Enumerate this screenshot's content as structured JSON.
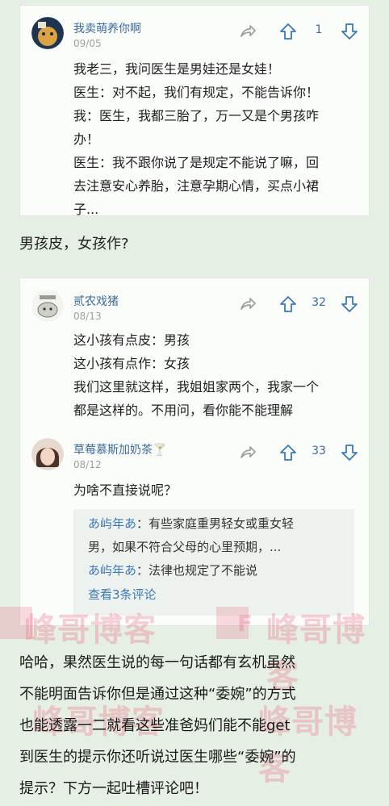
{
  "comment1": {
    "username": "我卖萌养你啊",
    "date": "09/05",
    "like_count": "1",
    "lines": [
      "我老三，我问医生是男娃还是女娃！",
      "医生：对不起，我们有规定，不能告诉你！",
      "我：医生，我都三胎了，万一又是个男孩咋",
      "办！",
      "医生：我不跟你说了是规定不能说了嘛，回",
      "去注意安心养胎，注意孕期心情，买点小裙",
      "子..."
    ]
  },
  "middle_text": "男孩皮，女孩作?",
  "comment2": {
    "username": "贰农戏猪",
    "date": "08/13",
    "like_count": "32",
    "lines": [
      "这小孩有点皮：男孩",
      "这小孩有点作：女孩",
      "我们这里就这样，我姐姐家两个，我家一个",
      "都是这样的。不用问，看你能不能理解"
    ]
  },
  "comment3": {
    "username": "草莓慕斯加奶茶🍸",
    "date": "08/12",
    "like_count": "33",
    "lines": [
      "为啥不直接说呢？"
    ],
    "replies": [
      {
        "name": "あ屿年あ",
        "text": "：有些家庭重男轻女或重女轻",
        "cont": "男，如果不符合父母的心里预期，..."
      },
      {
        "name": "あ屿年あ",
        "text": "：法律也规定了不能说"
      }
    ],
    "more": "查看3条评论"
  },
  "bottom_text": [
    "哈哈，果然医生说的每一句话都有玄机虽然",
    "不能明面告诉你但是通过这种“委婉”的方式",
    "也能透露一二就看这些准爸妈们能不能get",
    "到医生的提示你还听说过医生哪些“委婉”的",
    "提示？下方一起吐槽评论吧！"
  ],
  "watermark": {
    "text": "峰哥博客",
    "letter": "F"
  },
  "colors": {
    "accent": "#3b6a9f",
    "background": "#e6efe4"
  },
  "icons": {
    "share": "share-icon",
    "upvote": "up-arrow-icon",
    "downvote": "down-arrow-icon"
  }
}
